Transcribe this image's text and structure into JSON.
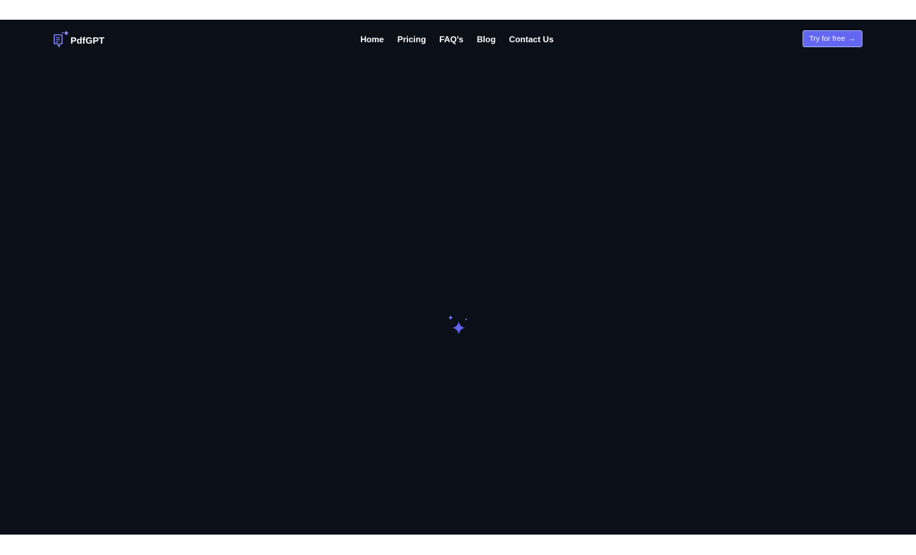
{
  "brand": {
    "name": "PdfGPT",
    "icon": "pdf-chat-sparkle-icon",
    "accent_color": "#6366f1"
  },
  "nav": {
    "items": [
      {
        "label": "Home"
      },
      {
        "label": "Pricing"
      },
      {
        "label": "FAQ's"
      },
      {
        "label": "Blog"
      },
      {
        "label": "Contact Us"
      }
    ]
  },
  "cta": {
    "label": "Try for free",
    "icon": "arrow-right-icon",
    "arrow_glyph": "→"
  },
  "loader": {
    "icon": "sparkle-icon",
    "color": "#6366f1"
  },
  "theme": {
    "background": "#0b0f17",
    "text": "#ffffff"
  }
}
